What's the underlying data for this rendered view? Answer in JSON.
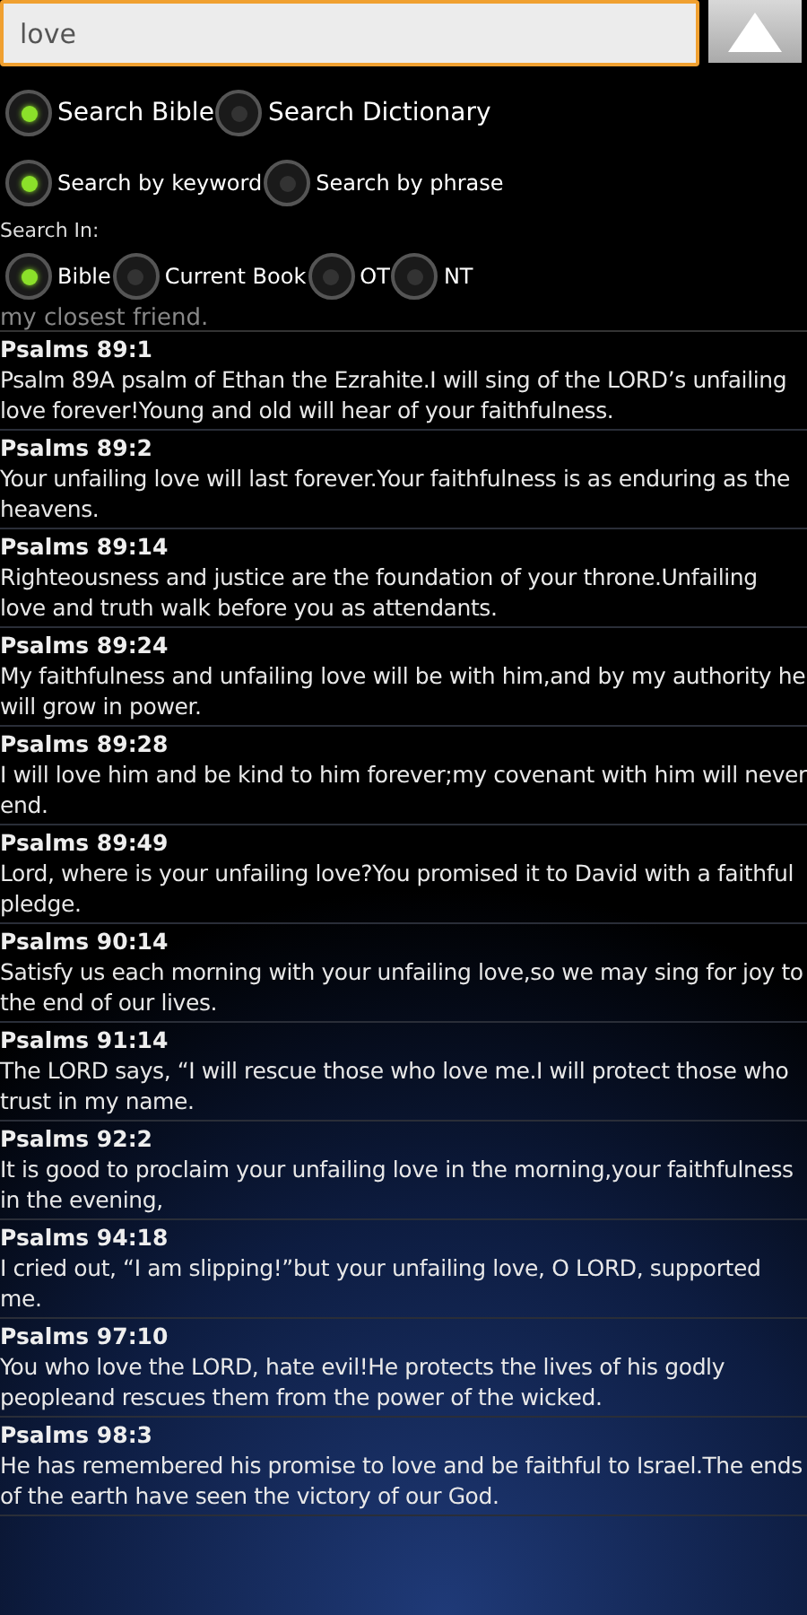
{
  "search": {
    "value": "love"
  },
  "mode_options": [
    {
      "label": "Search Bible",
      "selected": true
    },
    {
      "label": "Search Dictionary",
      "selected": false
    }
  ],
  "match_options": [
    {
      "label": "Search by keyword",
      "selected": true
    },
    {
      "label": "Search by phrase",
      "selected": false
    }
  ],
  "scope_label": "Search In:",
  "scope_options": [
    {
      "label": "Bible",
      "selected": true
    },
    {
      "label": "Current Book",
      "selected": false
    },
    {
      "label": "OT",
      "selected": false
    },
    {
      "label": "NT",
      "selected": false
    }
  ],
  "partial_text": "my closest friend.",
  "results": [
    {
      "reference": "Psalms 89:1",
      "text": "Psalm 89A psalm of Ethan the Ezrahite.I will sing of the LORD’s unfailing love forever!Young and old will hear of your faithfulness."
    },
    {
      "reference": "Psalms 89:2",
      "text": "Your unfailing love will last forever.Your faithfulness is as enduring as the heavens."
    },
    {
      "reference": "Psalms 89:14",
      "text": "Righteousness and justice are the foundation of your throne.Unfailing love and truth walk before you as attendants."
    },
    {
      "reference": "Psalms 89:24",
      "text": "My faithfulness and unfailing love will be with him,and by my authority he will grow in power."
    },
    {
      "reference": "Psalms 89:28",
      "text": "I will love him and be kind to him forever;my covenant with him will never end."
    },
    {
      "reference": "Psalms 89:49",
      "text": "Lord, where is your unfailing love?You promised it to David with a faithful pledge."
    },
    {
      "reference": "Psalms 90:14",
      "text": "Satisfy us each morning with your unfailing love,so we may sing for joy to the end of our lives."
    },
    {
      "reference": "Psalms 91:14",
      "text": "The LORD says, “I will rescue those who love me.I will protect those who trust in my name."
    },
    {
      "reference": "Psalms 92:2",
      "text": "It is good to proclaim your unfailing love in the morning,your faithfulness in the evening,"
    },
    {
      "reference": "Psalms 94:18",
      "text": "I cried out, “I am slipping!”but your unfailing love, O LORD, supported me."
    },
    {
      "reference": "Psalms 97:10",
      "text": "You who love the LORD, hate evil!He protects the lives of his godly peopleand rescues them from the power of the wicked."
    },
    {
      "reference": "Psalms 98:3",
      "text": "He has remembered his promise to love and be faithful to Israel.The ends of the earth have seen the victory of our God."
    }
  ]
}
